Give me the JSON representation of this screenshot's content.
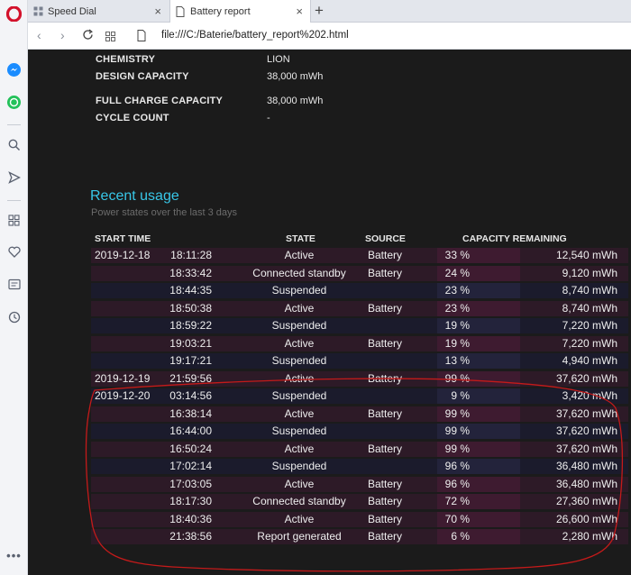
{
  "browser": {
    "tabs": [
      {
        "label": "Speed Dial",
        "active": false
      },
      {
        "label": "Battery report",
        "active": true
      }
    ],
    "url": "file:///C:/Baterie/battery_report%202.html"
  },
  "sidebar_icons": [
    "opera-logo-icon",
    "messenger-icon",
    "whatsapp-icon",
    "search-icon",
    "send-icon",
    "speed-dial-icon",
    "heart-icon",
    "news-icon",
    "history-icon",
    "more-icon"
  ],
  "battery_info": [
    {
      "label": "CHEMISTRY",
      "value": "LION"
    },
    {
      "label": "DESIGN CAPACITY",
      "value": "38,000 mWh"
    },
    {
      "label": "FULL CHARGE CAPACITY",
      "value": "38,000 mWh"
    },
    {
      "label": "CYCLE COUNT",
      "value": "-"
    }
  ],
  "recent_usage": {
    "title": "Recent usage",
    "subtitle": "Power states over the last 3 days",
    "headers": {
      "start_time": "START TIME",
      "state": "STATE",
      "source": "SOURCE",
      "capacity": "CAPACITY REMAINING"
    },
    "rows": [
      {
        "date": "2019-12-18",
        "time": "18:11:28",
        "state": "Active",
        "source": "Battery",
        "pct": "33 %",
        "cap": "12,540 mWh",
        "kind": "active"
      },
      {
        "date": "",
        "time": "18:33:42",
        "state": "Connected standby",
        "source": "Battery",
        "pct": "24 %",
        "cap": "9,120 mWh",
        "kind": "active"
      },
      {
        "date": "",
        "time": "18:44:35",
        "state": "Suspended",
        "source": "",
        "pct": "23 %",
        "cap": "8,740 mWh",
        "kind": "suspended"
      },
      {
        "date": "",
        "time": "18:50:38",
        "state": "Active",
        "source": "Battery",
        "pct": "23 %",
        "cap": "8,740 mWh",
        "kind": "active"
      },
      {
        "date": "",
        "time": "18:59:22",
        "state": "Suspended",
        "source": "",
        "pct": "19 %",
        "cap": "7,220 mWh",
        "kind": "suspended"
      },
      {
        "date": "",
        "time": "19:03:21",
        "state": "Active",
        "source": "Battery",
        "pct": "19 %",
        "cap": "7,220 mWh",
        "kind": "active"
      },
      {
        "date": "",
        "time": "19:17:21",
        "state": "Suspended",
        "source": "",
        "pct": "13 %",
        "cap": "4,940 mWh",
        "kind": "suspended"
      },
      {
        "date": "2019-12-19",
        "time": "21:59:56",
        "state": "Active",
        "source": "Battery",
        "pct": "99 %",
        "cap": "37,620 mWh",
        "kind": "active"
      },
      {
        "date": "2019-12-20",
        "time": "03:14:56",
        "state": "Suspended",
        "source": "",
        "pct": "9 %",
        "cap": "3,420 mWh",
        "kind": "suspended"
      },
      {
        "date": "",
        "time": "16:38:14",
        "state": "Active",
        "source": "Battery",
        "pct": "99 %",
        "cap": "37,620 mWh",
        "kind": "active"
      },
      {
        "date": "",
        "time": "16:44:00",
        "state": "Suspended",
        "source": "",
        "pct": "99 %",
        "cap": "37,620 mWh",
        "kind": "suspended"
      },
      {
        "date": "",
        "time": "16:50:24",
        "state": "Active",
        "source": "Battery",
        "pct": "99 %",
        "cap": "37,620 mWh",
        "kind": "active"
      },
      {
        "date": "",
        "time": "17:02:14",
        "state": "Suspended",
        "source": "",
        "pct": "96 %",
        "cap": "36,480 mWh",
        "kind": "suspended"
      },
      {
        "date": "",
        "time": "17:03:05",
        "state": "Active",
        "source": "Battery",
        "pct": "96 %",
        "cap": "36,480 mWh",
        "kind": "active"
      },
      {
        "date": "",
        "time": "18:17:30",
        "state": "Connected standby",
        "source": "Battery",
        "pct": "72 %",
        "cap": "27,360 mWh",
        "kind": "active"
      },
      {
        "date": "",
        "time": "18:40:36",
        "state": "Active",
        "source": "Battery",
        "pct": "70 %",
        "cap": "26,600 mWh",
        "kind": "active"
      },
      {
        "date": "",
        "time": "21:38:56",
        "state": "Report generated",
        "source": "Battery",
        "pct": "6 %",
        "cap": "2,280 mWh",
        "kind": "active"
      }
    ]
  },
  "colors": {
    "active_row": "#2d1a27",
    "suspended_row": "#1b1b2c",
    "active_pct": "#3e1b30",
    "suspended_pct": "#23233b",
    "accent_title": "#38c7e8",
    "annotation": "#c41a1a"
  }
}
